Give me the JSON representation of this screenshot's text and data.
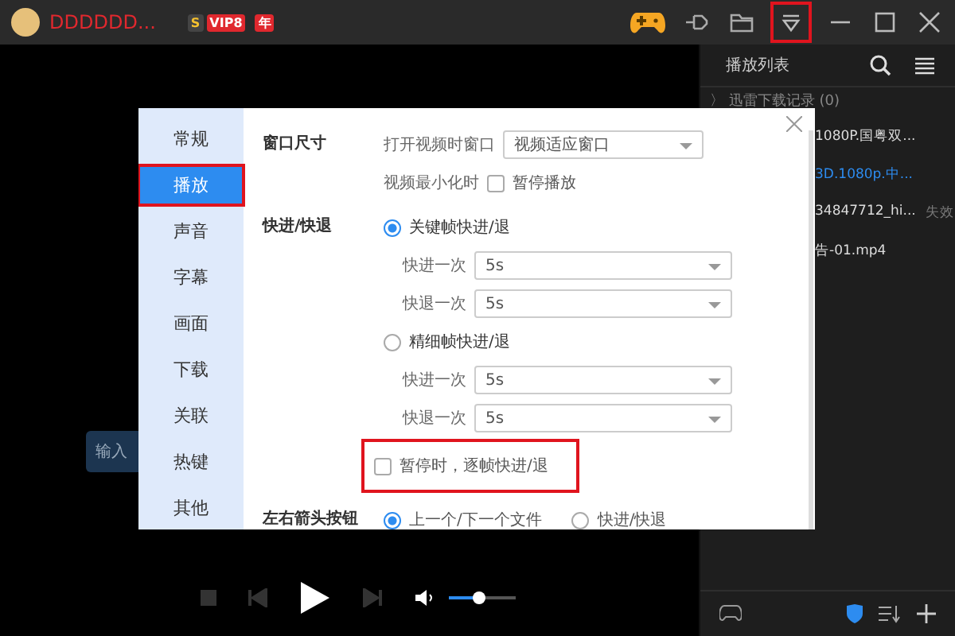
{
  "title_bar": {
    "user_name": "DDDDDD...",
    "badges": [
      {
        "text": "S",
        "kind": "level"
      },
      {
        "text": "VIP8",
        "kind": "vip"
      },
      {
        "text": "年",
        "kind": "year"
      }
    ],
    "menu_highlighted": true
  },
  "video": {
    "hint": "输入"
  },
  "playlist": {
    "title": "播放列表",
    "group": "〉 迅雷下载记录 (0)",
    "items": [
      {
        "name": "1080P.国粤双...",
        "selected": false
      },
      {
        "name": "3D.1080p.中...",
        "selected": true
      },
      {
        "name": "34847712_hi...",
        "selected": false,
        "status": "失效"
      },
      {
        "name": "告-01.mp4",
        "selected": false
      }
    ]
  },
  "settings": {
    "nav": [
      {
        "label": "常规",
        "selected": false,
        "highlighted": false
      },
      {
        "label": "播放",
        "selected": true,
        "highlighted": true
      },
      {
        "label": "声音",
        "selected": false,
        "highlighted": false
      },
      {
        "label": "字幕",
        "selected": false,
        "highlighted": false
      },
      {
        "label": "画面",
        "selected": false,
        "highlighted": false
      },
      {
        "label": "下载",
        "selected": false,
        "highlighted": false
      },
      {
        "label": "关联",
        "selected": false,
        "highlighted": false
      },
      {
        "label": "热键",
        "selected": false,
        "highlighted": false
      },
      {
        "label": "其他",
        "selected": false,
        "highlighted": false
      }
    ],
    "window_size": {
      "label": "窗口尺寸",
      "open_label": "打开视频时窗口",
      "open_value": "视频适应窗口",
      "minimize_label": "视频最小化时",
      "pause_label": "暂停播放",
      "pause_checked": false
    },
    "seek": {
      "label": "快进/快退",
      "modes": [
        {
          "label": "关键帧快进/退",
          "selected": true,
          "forward_label": "快进一次",
          "forward_value": "5s",
          "back_label": "快退一次",
          "back_value": "5s"
        },
        {
          "label": "精细帧快进/退",
          "selected": false,
          "forward_label": "快进一次",
          "forward_value": "5s",
          "back_label": "快退一次",
          "back_value": "5s"
        }
      ],
      "frame_step_label": "暂停时，逐帧快进/退",
      "frame_step_checked": false,
      "frame_step_highlighted": true
    },
    "arrow_keys": {
      "label": "左右箭头按钮",
      "options": [
        {
          "label": "上一个/下一个文件",
          "selected": true
        },
        {
          "label": "快进/快退",
          "selected": false
        }
      ]
    }
  },
  "controls": {
    "volume": {
      "level": 0.45
    }
  }
}
